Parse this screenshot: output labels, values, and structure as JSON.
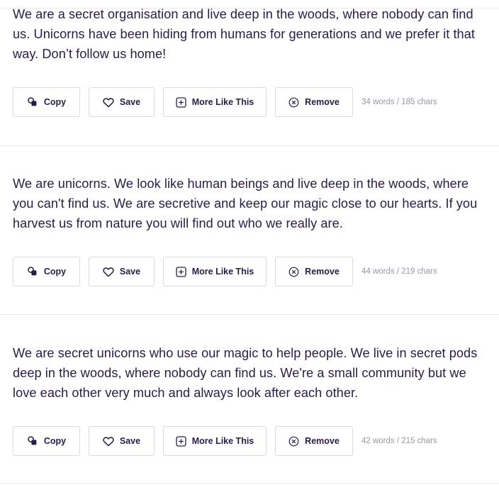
{
  "results": [
    {
      "text": "We are a secret organisation and live deep in the woods, where nobody can find us. Unicorns have been hiding from humans for generations and we prefer it that way. Don’t follow us home!",
      "counts": "34 words / 185 chars"
    },
    {
      "text": "We are unicorns. We look like human beings and live deep in the woods, where you can't find us. We are secretive and keep our magic close to our hearts. If you harvest us from nature you will find out who we really are.",
      "counts": "44 words / 219 chars"
    },
    {
      "text": "We are secret unicorns who use our magic to help people. We live in secret pods deep in the woods, where nobody can find us. We're a small community but we love each other very much and always look after each other.",
      "counts": "42 words / 215 chars"
    }
  ],
  "actions": {
    "copy_label": "Copy",
    "save_label": "Save",
    "more_label": "More Like This",
    "remove_label": "Remove"
  },
  "icons": {
    "copy": "copy-icon",
    "save": "heart-icon",
    "more": "plus-square-icon",
    "remove": "x-circle-icon"
  },
  "colors": {
    "text": "#2a1c47",
    "muted": "#9a95a8",
    "border": "#dcd8e4",
    "divider": "#ece9f1"
  }
}
